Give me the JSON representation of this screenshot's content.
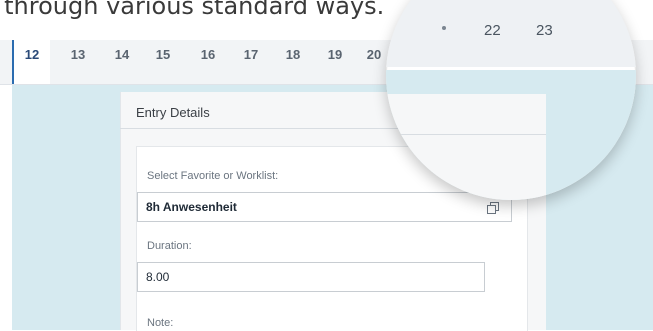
{
  "caption": "s through various standard ways.",
  "days": {
    "visible": [
      "12",
      "13",
      "14",
      "15",
      "16",
      "17",
      "18",
      "19",
      "20"
    ],
    "selected": "12",
    "magnified": [
      "22",
      "23"
    ]
  },
  "entry": {
    "title": "Entry Details",
    "favorite": {
      "label": "Select Favorite or Worklist:",
      "value": "8h Anwesenheit",
      "icon": "value-help-icon"
    },
    "duration": {
      "label": "Duration:",
      "value": "8.00"
    },
    "note": {
      "label": "Note:"
    }
  },
  "colors": {
    "accent": "#2b6cb0",
    "panel_bg": "#d6eaf0"
  }
}
